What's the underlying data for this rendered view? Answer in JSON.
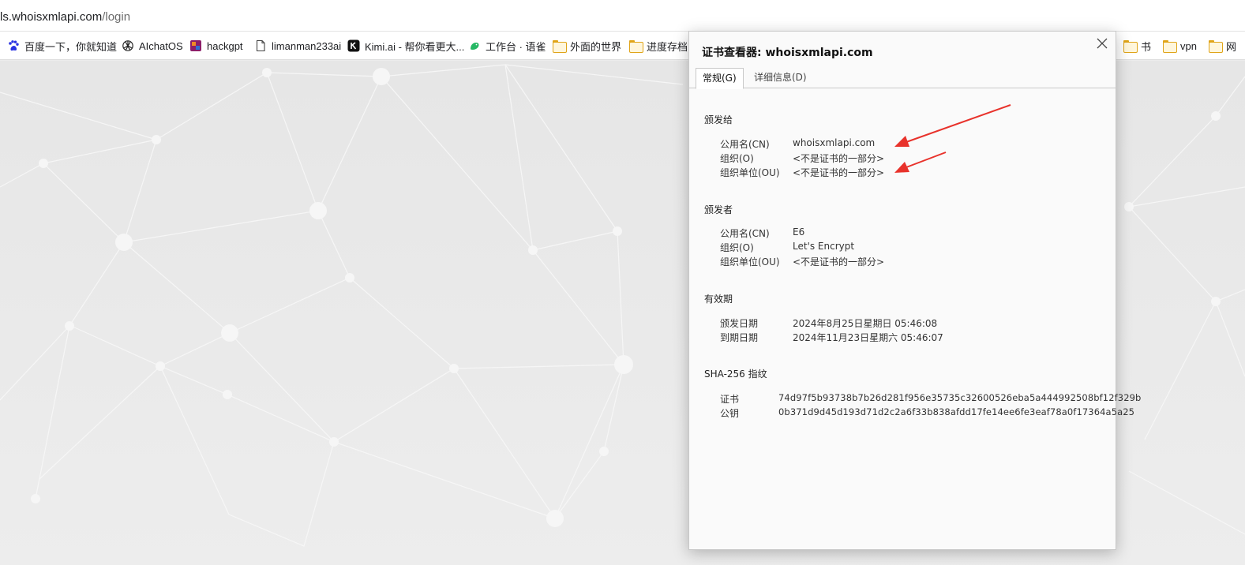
{
  "address_bar": {
    "host": "ls.whoisxmlapi.com",
    "path": "/login"
  },
  "bookmarks": [
    {
      "label": "百度一下，你就知道",
      "icon": "baidu-paw-icon"
    },
    {
      "label": "AIchatOS",
      "icon": "openai-knot-icon"
    },
    {
      "label": "hackgpt",
      "icon": "hackgpt-logo-icon"
    },
    {
      "label": "limanman233ai",
      "icon": "page-icon"
    },
    {
      "label": "Kimi.ai - 帮你看更大...",
      "icon": "kimi-logo-icon"
    },
    {
      "label": "工作台 · 语雀",
      "icon": "yuque-logo-icon"
    },
    {
      "label": "外面的世界",
      "icon": "folder-icon"
    },
    {
      "label": "进度存档",
      "icon": "folder-icon"
    },
    {
      "label": "书",
      "icon": "folder-icon"
    },
    {
      "label": "vpn",
      "icon": "folder-icon"
    },
    {
      "label": "网",
      "icon": "folder-icon"
    }
  ],
  "dialog": {
    "title": "证书查看器: whoisxmlapi.com",
    "tabs": [
      {
        "label": "常规(G)",
        "active": true
      },
      {
        "label": "详细信息(D)",
        "active": false
      }
    ],
    "issued_to": {
      "title": "颁发给",
      "rows": [
        {
          "key": "公用名(CN)",
          "value": "whoisxmlapi.com"
        },
        {
          "key": "组织(O)",
          "value": "<不是证书的一部分>"
        },
        {
          "key": "组织单位(OU)",
          "value": "<不是证书的一部分>"
        }
      ]
    },
    "issued_by": {
      "title": "颁发者",
      "rows": [
        {
          "key": "公用名(CN)",
          "value": "E6"
        },
        {
          "key": "组织(O)",
          "value": "Let's Encrypt"
        },
        {
          "key": "组织单位(OU)",
          "value": "<不是证书的一部分>"
        }
      ]
    },
    "validity": {
      "title": "有效期",
      "rows": [
        {
          "key": "颁发日期",
          "value": "2024年8月25日星期日 05:46:08"
        },
        {
          "key": "到期日期",
          "value": "2024年11月23日星期六 05:46:07"
        }
      ]
    },
    "fingerprints": {
      "title": "SHA-256 指纹",
      "rows": [
        {
          "key": "证书",
          "value": "74d97f5b93738b7b26d281f956e35735c32600526eba5a444992508bf12f329b"
        },
        {
          "key": "公钥",
          "value": "0b371d9d45d193d71d2c2a6f33b838afdd17fe14ee6fe3eaf78a0f17364a5a25"
        }
      ]
    }
  },
  "colors": {
    "annotation_arrow": "#e8322b",
    "folder": "#e0a418"
  }
}
